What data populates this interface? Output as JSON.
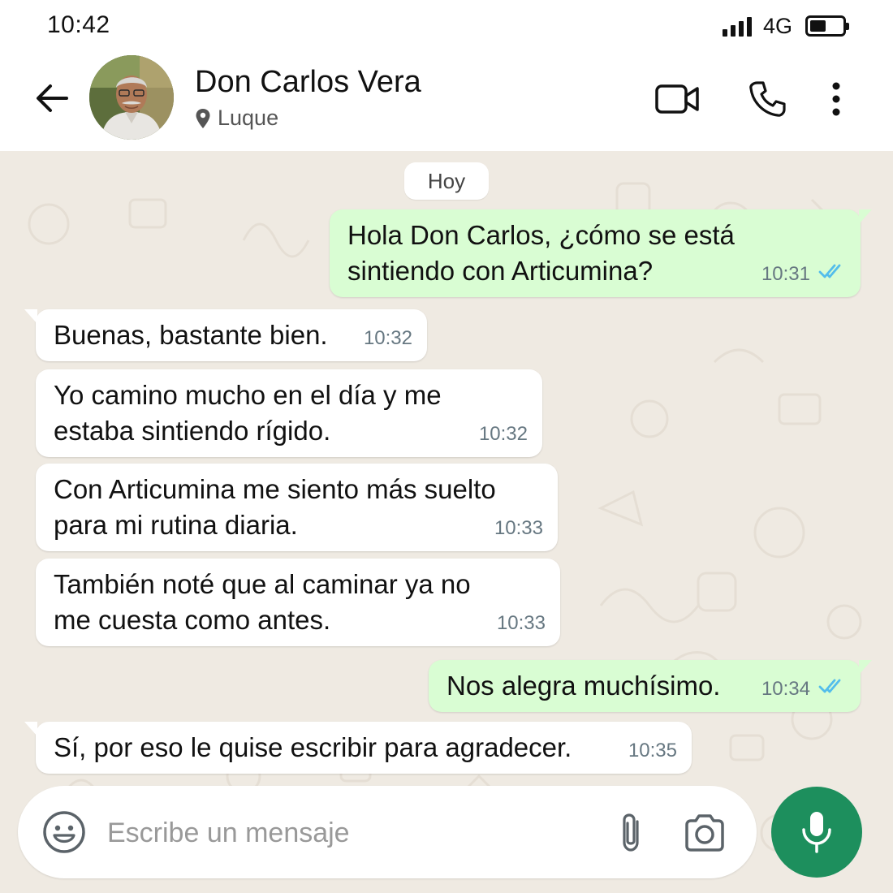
{
  "status_bar": {
    "time": "10:42",
    "network": "4G",
    "battery_level": 0.5
  },
  "header": {
    "contact_name": "Don Carlos Vera",
    "location": "Luque",
    "icons": {
      "back": "arrow-left-icon",
      "video": "video-camera-icon",
      "call": "phone-icon",
      "menu": "more-vertical-icon",
      "location": "location-pin-icon"
    }
  },
  "chat": {
    "date_label": "Hoy",
    "messages": [
      {
        "direction": "out",
        "text": "Hola Don Carlos, ¿cómo se está\nsintiendo con Articumina?",
        "time": "10:31",
        "status": "read"
      },
      {
        "direction": "in",
        "text": "Buenas, bastante bien.",
        "time": "10:32"
      },
      {
        "direction": "in",
        "text": "Yo camino mucho en el día y me\nestaba sintiendo rígido.",
        "time": "10:32"
      },
      {
        "direction": "in",
        "text": "Con Articumina me siento más suelto\npara mi rutina diaria.",
        "time": "10:33"
      },
      {
        "direction": "in",
        "text": "También noté que al caminar ya no\nme cuesta como antes.",
        "time": "10:33"
      },
      {
        "direction": "out",
        "text": "Nos alegra muchísimo.",
        "time": "10:34",
        "status": "read"
      },
      {
        "direction": "in",
        "text": "Sí, por eso le quise escribir para agradecer.",
        "time": "10:35"
      }
    ]
  },
  "composer": {
    "placeholder": "Escribe un mensaje",
    "value": "",
    "icons": {
      "emoji": "emoji-icon",
      "attach": "paperclip-icon",
      "camera": "camera-icon",
      "mic": "microphone-icon"
    }
  },
  "colors": {
    "outgoing_bubble": "#d9fdd3",
    "incoming_bubble": "#ffffff",
    "accent": "#1d8f5d",
    "read_ticks": "#53bdeb",
    "wallpaper": "#efeae2"
  }
}
